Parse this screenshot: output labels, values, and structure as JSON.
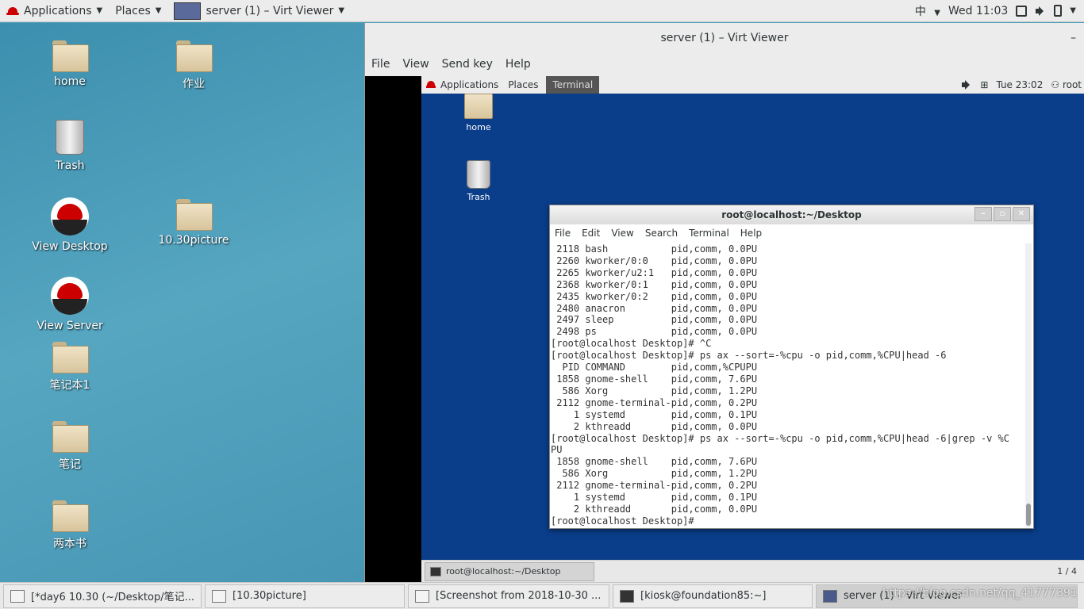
{
  "topbar": {
    "applications": "Applications",
    "places": "Places",
    "active_window": "server (1) – Virt Viewer",
    "input_method": "中",
    "clock": "Wed 11:03"
  },
  "desktop": {
    "icons": [
      "home",
      "作业",
      "Trash",
      "View Desktop",
      "10.30picture",
      "View Server",
      "笔记本1",
      "笔记",
      "两本书"
    ]
  },
  "virt_viewer": {
    "title": "server (1) – Virt Viewer",
    "menu": [
      "File",
      "View",
      "Send key",
      "Help"
    ]
  },
  "guest": {
    "topbar": {
      "applications": "Applications",
      "places": "Places",
      "terminal_tab": "Terminal",
      "clock": "Tue 23:02",
      "user": "root"
    },
    "icons": [
      "home",
      "Trash"
    ],
    "terminal": {
      "title": "root@localhost:~/Desktop",
      "menu": [
        "File",
        "Edit",
        "View",
        "Search",
        "Terminal",
        "Help"
      ],
      "lines": [
        " 2118 bash           pid,comm, 0.0PU",
        " 2260 kworker/0:0    pid,comm, 0.0PU",
        " 2265 kworker/u2:1   pid,comm, 0.0PU",
        " 2368 kworker/0:1    pid,comm, 0.0PU",
        " 2435 kworker/0:2    pid,comm, 0.0PU",
        " 2480 anacron        pid,comm, 0.0PU",
        " 2497 sleep          pid,comm, 0.0PU",
        " 2498 ps             pid,comm, 0.0PU",
        "[root@localhost Desktop]# ^C",
        "[root@localhost Desktop]# ps ax --sort=-%cpu -o pid,comm,%CPU|head -6",
        "  PID COMMAND        pid,comm,%CPUPU",
        " 1858 gnome-shell    pid,comm, 7.6PU",
        "  586 Xorg           pid,comm, 1.2PU",
        " 2112 gnome-terminal-pid,comm, 0.2PU",
        "    1 systemd        pid,comm, 0.1PU",
        "    2 kthreadd       pid,comm, 0.0PU",
        "[root@localhost Desktop]# ps ax --sort=-%cpu -o pid,comm,%CPU|head -6|grep -v %C",
        "PU",
        " 1858 gnome-shell    pid,comm, 7.6PU",
        "  586 Xorg           pid,comm, 1.2PU",
        " 2112 gnome-terminal-pid,comm, 0.2PU",
        "    1 systemd        pid,comm, 0.1PU",
        "    2 kthreadd       pid,comm, 0.0PU",
        "[root@localhost Desktop]# "
      ]
    },
    "taskbar": {
      "task": "root@localhost:~/Desktop",
      "pager": "1 / 4"
    }
  },
  "taskbar": {
    "items": [
      "[*day6 10.30 (~/Desktop/笔记...",
      "[10.30picture]",
      "[Screenshot from 2018-10-30 ...",
      "[kiosk@foundation85:~]",
      "server (1) – Virt Viewer"
    ],
    "pager": "1 / 4",
    "watermark": "https://blog.csdn.net/qq_41777391"
  }
}
